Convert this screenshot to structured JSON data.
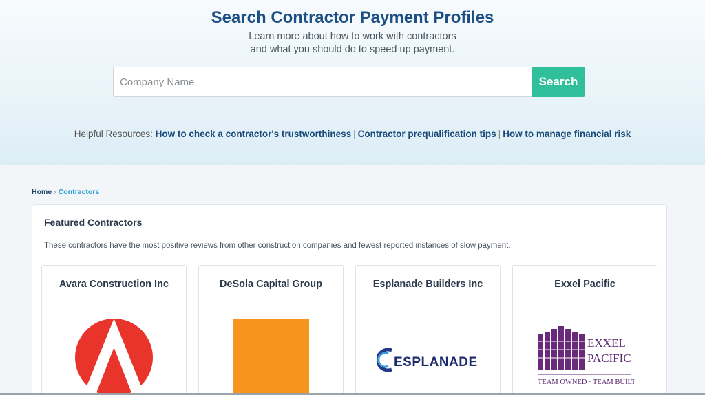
{
  "hero": {
    "title": "Search Contractor Payment Profiles",
    "subtitle_line1": "Learn more about how to work with contractors",
    "subtitle_line2": "and what you should do to speed up payment."
  },
  "search": {
    "placeholder": "Company Name",
    "button_label": "Search"
  },
  "resources": {
    "prefix": "Helpful Resources:",
    "links": [
      "How to check a contractor's trustworthiness",
      "Contractor prequalification tips",
      "How to manage financial risk"
    ],
    "separator": "|"
  },
  "breadcrumb": {
    "home": "Home",
    "separator": "›",
    "current": "Contractors"
  },
  "featured": {
    "title": "Featured Contractors",
    "description": "These contractors have the most positive reviews from other construction companies and fewest reported instances of slow payment.",
    "cards": [
      {
        "name": "Avara Construction Inc",
        "logo_icon": "avara-logo",
        "logo_color": "#e8342a"
      },
      {
        "name": "DeSola Capital Group",
        "logo_icon": "desola-logo",
        "logo_color": "#f7941d"
      },
      {
        "name": "Esplanade Builders Inc",
        "logo_icon": "esplanade-logo",
        "logo_color": "#2a3a8c"
      },
      {
        "name": "Exxel Pacific",
        "logo_icon": "exxel-pacific-logo",
        "logo_color": "#6a2a7a"
      }
    ]
  },
  "colors": {
    "accent": "#2fbf9a",
    "title": "#1d4f85",
    "link": "#1a4a7a",
    "breadcrumb_current": "#2a9fd1"
  }
}
